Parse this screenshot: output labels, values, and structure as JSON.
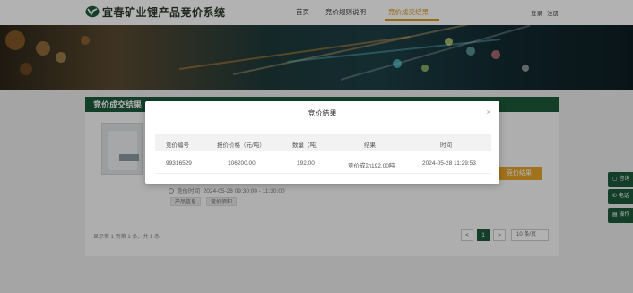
{
  "header": {
    "site_title": "宜春矿业锂产品竞价系统",
    "nav": [
      "首页",
      "竞价规则说明",
      "竞价成交结果"
    ],
    "auth": [
      "登录",
      "注册"
    ]
  },
  "section": {
    "title": "竞价成交结果",
    "bid_button": "竞价结果",
    "time_label": "竞价时间",
    "time_value": "2024-05-28  09:30:00 - 11:30:00",
    "tags": [
      "产品信息",
      "竞价须知"
    ]
  },
  "pagination": {
    "info": "显示第 1 到第 1 条，共 1 条",
    "pages": [
      "<",
      "1",
      ">"
    ],
    "page_size": "10 条/页"
  },
  "side_tools": [
    "咨询",
    "电话",
    "操作"
  ],
  "modal": {
    "title": "竞价结果",
    "close": "×",
    "columns": [
      "竞价编号",
      "报价价格（元/吨）",
      "数量（吨）",
      "结果",
      "时间"
    ],
    "rows": [
      [
        "99316529",
        "106200.00",
        "192.00",
        "竞价成功192.00吨",
        "2024-05-28 11:29:53"
      ]
    ]
  },
  "colors": {
    "brand_green": "#1c5a3a",
    "accent_orange": "#e5a42a"
  }
}
